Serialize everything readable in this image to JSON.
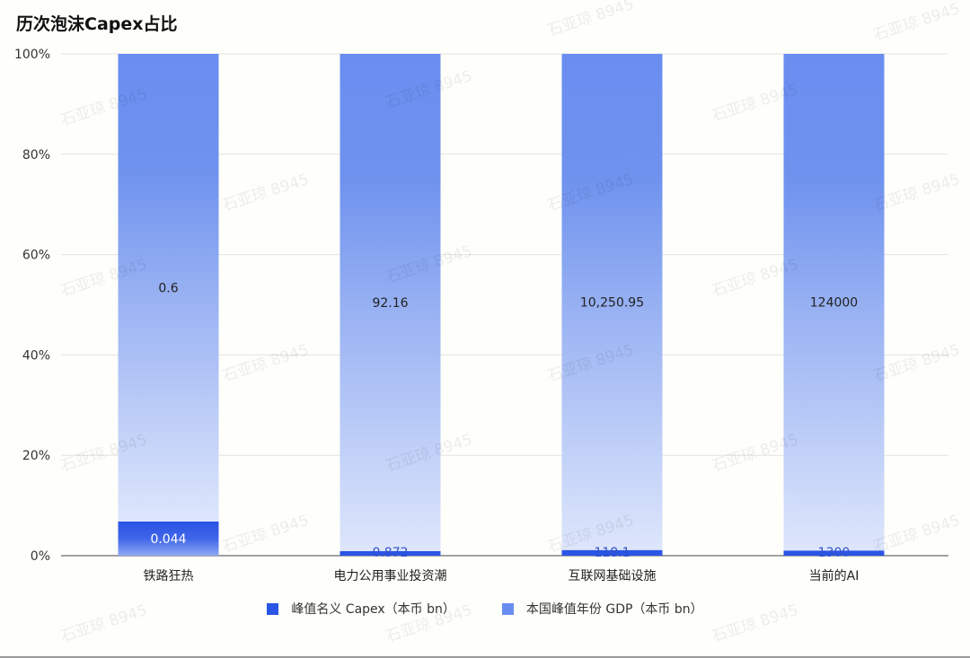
{
  "chart_data": {
    "type": "bar",
    "title": "历次泡沫Capex占比",
    "categories": [
      "铁路狂热",
      "电力公用事业投资潮",
      "互联网基础设施",
      "当前的AI"
    ],
    "series": [
      {
        "name": "峰值名义 Capex（本币 bn）",
        "values": [
          0.044,
          0.872,
          118.1,
          1300
        ],
        "share_pct": [
          6.8,
          0.9,
          1.1,
          1.0
        ],
        "labels": [
          "0.044",
          "0.872",
          "118.1",
          "1300"
        ],
        "color": "#2b55e6"
      },
      {
        "name": "本国峰值年份 GDP（本币 bn）",
        "values": [
          0.6,
          92.16,
          10250.95,
          124000
        ],
        "share_pct": [
          93.2,
          99.1,
          98.9,
          99.0
        ],
        "labels": [
          "0.6",
          "92.16",
          "10,250.95",
          "124000"
        ],
        "color": "#6a8ef0"
      }
    ],
    "stacked": "percent",
    "ylim": [
      0,
      100
    ],
    "yticks": [
      "0%",
      "20%",
      "40%",
      "60%",
      "80%",
      "100%"
    ],
    "grid": true,
    "legend_position": "bottom-center"
  },
  "watermark": "石亚琼 8945"
}
